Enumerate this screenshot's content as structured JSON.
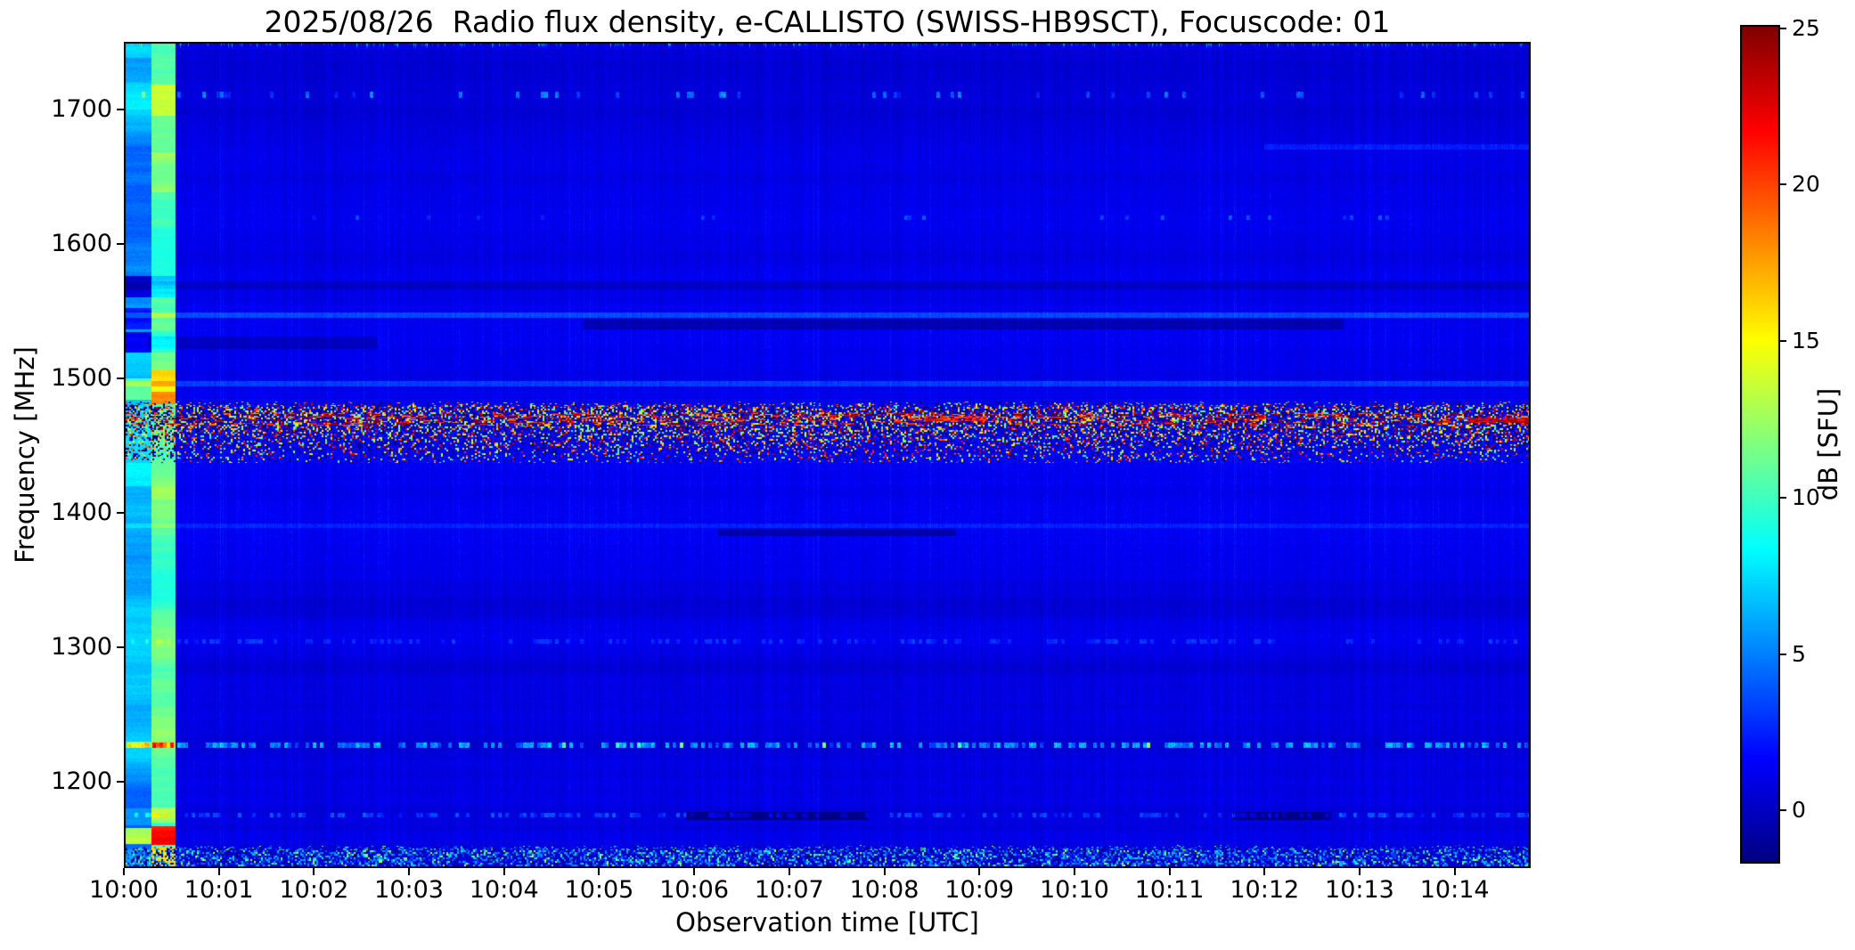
{
  "figure": {
    "title": "2025/08/26  Radio flux density, e-CALLISTO (SWISS-HB9SCT), Focuscode: 01"
  },
  "chart_data": {
    "type": "heatmap",
    "subtype": "radio-spectrogram",
    "title": "2025/08/26  Radio flux density, e-CALLISTO (SWISS-HB9SCT), Focuscode: 01",
    "xlabel": "Observation time [UTC]",
    "ylabel": "Frequency [MHz]",
    "colorbar_label": "dB [SFU]",
    "colormap": "jet",
    "grid": false,
    "legend": false,
    "x_tick_labels": [
      "10:00",
      "10:01",
      "10:02",
      "10:03",
      "10:04",
      "10:05",
      "10:06",
      "10:07",
      "10:08",
      "10:09",
      "10:10",
      "10:11",
      "10:12",
      "10:13",
      "10:14"
    ],
    "x_tick_seconds": [
      0,
      60,
      120,
      180,
      240,
      300,
      360,
      420,
      480,
      540,
      600,
      660,
      720,
      780,
      840
    ],
    "time_span_seconds": 888,
    "y_tick_values": [
      1700,
      1600,
      1500,
      1400,
      1300,
      1200
    ],
    "freq_range_mhz": [
      1136,
      1750
    ],
    "value_range_db": [
      -1.7,
      25.1
    ],
    "colorbar_tick_values": [
      25,
      20,
      15,
      10,
      5,
      0
    ],
    "background": {
      "base_db": 0.9,
      "pixel_noise_db": 0.5,
      "row_walk_step": 0.18,
      "row_clamp": 0.5,
      "col_noise_std": 0.42,
      "col_clamp_lo": -0.9,
      "col_clamp_hi": 1.25,
      "bright_streak_p": 0.05,
      "bright_streak_amp": 0.55
    },
    "calibration_columns": [
      {
        "name": "startup-column",
        "t_s": [
          0,
          17.5
        ],
        "base_db": 5.5,
        "stripe_step": 0.5,
        "bands": [
          {
            "f_mhz": [
              1738,
              1750
            ],
            "amp": 1.5
          },
          {
            "f_mhz": [
              1700,
              1720
            ],
            "amp": 0.8
          },
          {
            "f_mhz": [
              1560,
              1576
            ],
            "amp": -4.5
          },
          {
            "f_mhz": [
              1536,
              1552
            ],
            "amp": -3.2
          },
          {
            "f_mhz": [
              1519,
              1534
            ],
            "amp": -5.0
          },
          {
            "f_mhz": [
              1484,
              1500
            ],
            "amp": 4.0
          },
          {
            "f_mhz": [
              1420,
              1437
            ],
            "amp": 1.0
          },
          {
            "f_mhz": [
              1225,
              1230
            ],
            "amp": 3.5
          },
          {
            "f_mhz": [
              1168,
              1180
            ],
            "amp": 1.5
          },
          {
            "f_mhz": [
              1154,
              1166
            ],
            "amp": 8.5
          },
          {
            "f_mhz": [
              1136,
              1150
            ],
            "amp": 1.5
          }
        ]
      },
      {
        "name": "calibration-column",
        "t_s": [
          17.5,
          32.5
        ],
        "base_db": 10.5,
        "stripe_step": 0.55,
        "bands": [
          {
            "f_mhz": [
              1695,
              1718
            ],
            "amp": 3.0
          },
          {
            "f_mhz": [
              1638,
              1668
            ],
            "amp": 2.2
          },
          {
            "f_mhz": [
              1560,
              1576
            ],
            "amp": -2.2
          },
          {
            "f_mhz": [
              1519,
              1535
            ],
            "amp": -1.5
          },
          {
            "f_mhz": [
              1490,
              1506
            ],
            "amp": 4.5
          },
          {
            "f_mhz": [
              1481,
              1490
            ],
            "amp": 8.0
          },
          {
            "f_mhz": [
              1410,
              1440
            ],
            "amp": 1.5
          },
          {
            "f_mhz": [
              1225,
              1230
            ],
            "amp": 4.5
          },
          {
            "f_mhz": [
              1170,
              1181
            ],
            "amp": 3.0
          },
          {
            "f_mhz": [
              1153,
              1167
            ],
            "amp": 12.0
          },
          {
            "f_mhz": [
              1136,
              1152
            ],
            "amp": 6.0
          }
        ]
      }
    ],
    "features": [
      {
        "name": "interference-band-1440-1483",
        "type": "activity_speckle",
        "f_mhz": [
          1437,
          1483
        ],
        "core_f_mhz": [
          1465,
          1474
        ],
        "t_s": [
          0,
          888
        ]
      },
      {
        "name": "red-streak-far-right",
        "type": "streak",
        "f_mhz": [
          1467,
          1471
        ],
        "t_s": [
          850,
          888
        ],
        "amp": [
          21,
          25
        ],
        "p": 0.9
      },
      {
        "name": "red-streak-mid",
        "type": "streak",
        "f_mhz": [
          1468,
          1472
        ],
        "t_s": [
          505,
          545
        ],
        "amp": [
          19,
          24
        ],
        "p": 0.7
      },
      {
        "name": "bottom-interference-band",
        "type": "bottom_speckle",
        "f_mhz": [
          1136,
          1153
        ],
        "t_s": [
          0,
          888
        ]
      },
      {
        "name": "gps-l2-dashed-line-1227",
        "type": "dashes",
        "f_mhz": [
          1225,
          1229
        ],
        "t_s": [
          0,
          888
        ],
        "p": 0.58,
        "amp": [
          3.5,
          8.5
        ],
        "p_rare": 0.02,
        "amp_rare": [
          11,
          15
        ]
      },
      {
        "name": "faint-dashed-line-1176",
        "type": "dashes",
        "f_mhz": [
          1174,
          1177
        ],
        "t_s": [
          0,
          888
        ],
        "p": 0.4,
        "amp": [
          1.8,
          4.3
        ]
      },
      {
        "name": "sparse-dashes-1710",
        "type": "dashes",
        "f_mhz": [
          1708,
          1713
        ],
        "t_s": [
          0,
          888
        ],
        "p": 0.1,
        "amp": [
          2,
          6
        ]
      },
      {
        "name": "sparse-dashes-1620",
        "type": "dashes",
        "f_mhz": [
          1618,
          1621
        ],
        "t_s": [
          0,
          888
        ],
        "p": 0.06,
        "amp": [
          1.5,
          3.5
        ]
      },
      {
        "name": "faint-dashes-1304",
        "type": "dashes",
        "f_mhz": [
          1303,
          1306
        ],
        "t_s": [
          0,
          888
        ],
        "p": 0.3,
        "amp": [
          1.2,
          2.8
        ]
      },
      {
        "name": "light-line-1547",
        "type": "add",
        "f_mhz": [
          1545,
          1549
        ],
        "t_s": [
          0,
          888
        ],
        "amp": 2.3
      },
      {
        "name": "dark-band-1540",
        "type": "add",
        "f_mhz": [
          1536,
          1544
        ],
        "t_s": [
          290,
          770
        ],
        "amp": -1.6
      },
      {
        "name": "dark-band-1527",
        "type": "add",
        "f_mhz": [
          1522,
          1531
        ],
        "t_s": [
          15,
          160
        ],
        "amp": -1.3
      },
      {
        "name": "dark-line-1569",
        "type": "add",
        "f_mhz": [
          1566,
          1572
        ],
        "t_s": [
          0,
          888
        ],
        "amp": -0.8
      },
      {
        "name": "light-line-1496",
        "type": "add",
        "f_mhz": [
          1494,
          1498
        ],
        "t_s": [
          0,
          888
        ],
        "amp": 2.2
      },
      {
        "name": "light-line-1390",
        "type": "add",
        "f_mhz": [
          1389,
          1392
        ],
        "t_s": [
          0,
          888
        ],
        "amp": 1.1
      },
      {
        "name": "dark-line-1385",
        "type": "add",
        "f_mhz": [
          1383,
          1388
        ],
        "t_s": [
          375,
          525
        ],
        "amp": -1.9
      },
      {
        "name": "dark-segment-1176-a",
        "type": "add",
        "f_mhz": [
          1172,
          1178
        ],
        "t_s": [
          355,
          470
        ],
        "amp": -2.4
      },
      {
        "name": "dark-segment-1176-b",
        "type": "add",
        "f_mhz": [
          1172,
          1178
        ],
        "t_s": [
          700,
          762
        ],
        "amp": -2.4
      },
      {
        "name": "light-line-1672-right",
        "type": "add",
        "f_mhz": [
          1670,
          1674
        ],
        "t_s": [
          720,
          888
        ],
        "amp": 1.4
      },
      {
        "name": "top-edge-spikes",
        "type": "top_spikes",
        "f_mhz": [
          1742,
          1750
        ],
        "t_s": [
          0,
          888
        ],
        "p": 0.28,
        "amp": [
          2.5,
          10
        ]
      }
    ]
  },
  "colors": {
    "frame": "#000000",
    "page_background": "#ffffff",
    "text": "#000000"
  }
}
